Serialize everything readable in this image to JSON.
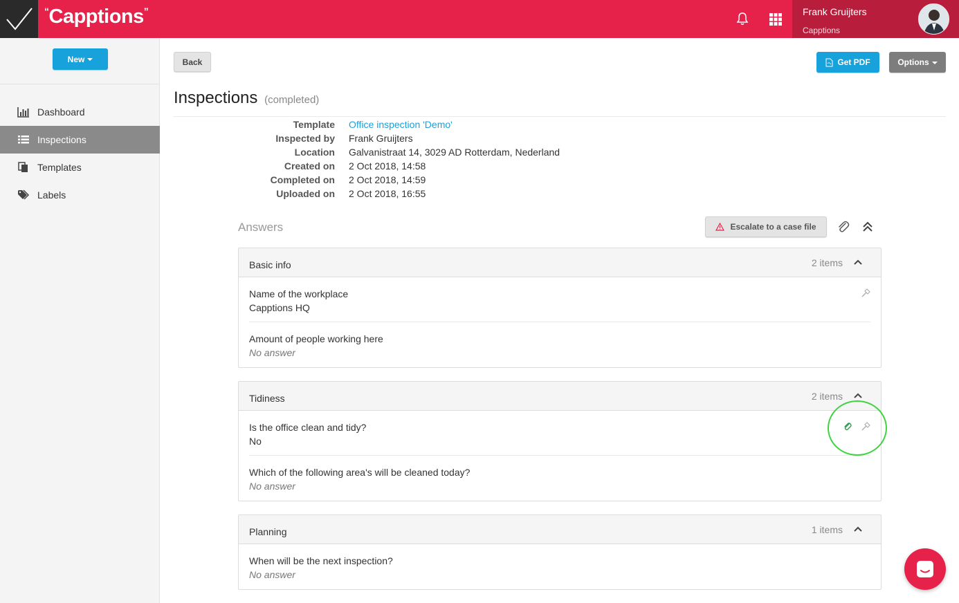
{
  "app": {
    "logo_text": "Capptions",
    "user_name": "Frank Gruijters",
    "user_org": "Capptions"
  },
  "sidebar": {
    "new_label": "New",
    "items": [
      {
        "label": "Dashboard",
        "icon": "bar-chart-icon"
      },
      {
        "label": "Inspections",
        "icon": "list-icon",
        "active": true
      },
      {
        "label": "Templates",
        "icon": "copy-icon"
      },
      {
        "label": "Labels",
        "icon": "tags-icon"
      }
    ]
  },
  "toolbar": {
    "back_label": "Back",
    "pdf_label": "Get PDF",
    "options_label": "Options"
  },
  "page": {
    "title": "Inspections",
    "status": "(completed)"
  },
  "meta": [
    {
      "label": "Template",
      "value": "Office inspection 'Demo'",
      "link": true
    },
    {
      "label": "Inspected by",
      "value": "Frank Gruijters"
    },
    {
      "label": "Location",
      "value": "Galvanistraat 14, 3029 AD Rotterdam, Nederland"
    },
    {
      "label": "Created on",
      "value": "2 Oct 2018, 14:58"
    },
    {
      "label": "Completed on",
      "value": "2 Oct 2018, 14:59"
    },
    {
      "label": "Uploaded on",
      "value": "2 Oct 2018, 16:55"
    }
  ],
  "answers": {
    "title": "Answers",
    "escalate_label": "Escalate to a case file",
    "sections": [
      {
        "title": "Basic info",
        "count": "2 items",
        "items": [
          {
            "question": "Name of the workplace",
            "answer": "Capptions HQ",
            "empty": false,
            "icons": [
              "hammer-icon"
            ]
          },
          {
            "question": "Amount of people working here",
            "answer": "No answer",
            "empty": true,
            "icons": []
          }
        ]
      },
      {
        "title": "Tidiness",
        "count": "2 items",
        "items": [
          {
            "question": "Is the office clean and tidy?",
            "answer": "No",
            "empty": false,
            "icons": [
              "paperclip-icon",
              "hammer-icon"
            ]
          },
          {
            "question": "Which of the following area's will be cleaned today?",
            "answer": "No answer",
            "empty": true,
            "icons": []
          }
        ]
      },
      {
        "title": "Planning",
        "count": "1 items",
        "items": [
          {
            "question": "When will be the next inspection?",
            "answer": "No answer",
            "empty": true,
            "icons": []
          }
        ]
      }
    ]
  },
  "colors": {
    "brand_red": "#e6224a",
    "dark_red": "#b81e3c",
    "accent_blue": "#17a2dc",
    "highlight_green": "#3fd33f"
  }
}
